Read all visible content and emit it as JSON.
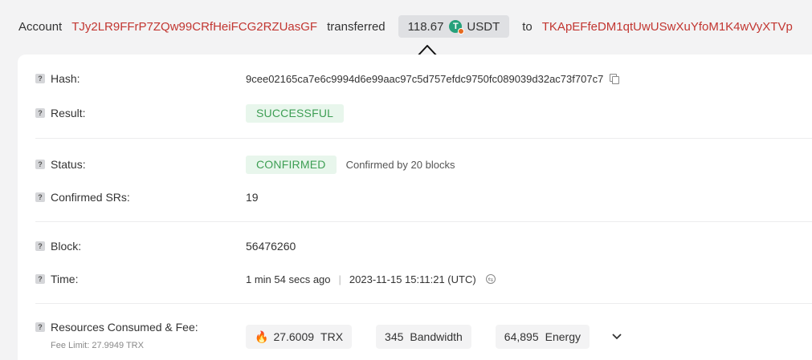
{
  "header": {
    "account_label": "Account",
    "from_address": "TJy2LR9FFrP7ZQw99CRfHeiFCG2RZUasGF",
    "transferred_label": "transferred",
    "amount": "118.67",
    "token_icon": "tether-icon",
    "token_symbol": "USDT",
    "to_label": "to",
    "to_address": "TKApEFfeDM1qtUwUSwXuYfoM1K4wVyXTVp"
  },
  "fields": {
    "hash": {
      "label": "Hash:",
      "value": "9cee02165ca7e6c9994d6e99aac97c5d757efdc9750fc089039d32ac73f707c7"
    },
    "result": {
      "label": "Result:",
      "value": "SUCCESSFUL"
    },
    "status": {
      "label": "Status:",
      "value": "CONFIRMED",
      "confirmed_prefix": "Confirmed by",
      "confirmed_count": "20",
      "confirmed_suffix": "blocks"
    },
    "confirmed_srs": {
      "label": "Confirmed SRs:",
      "value": "19"
    },
    "block": {
      "label": "Block:",
      "value": "56476260"
    },
    "time": {
      "label": "Time:",
      "relative": "1 min 54 secs ago",
      "separator": "|",
      "absolute": "2023-11-15 15:11:21 (UTC)"
    },
    "resources": {
      "label": "Resources Consumed & Fee:",
      "fee_limit": "Fee Limit: 27.9949 TRX",
      "trx_value": "27.6009",
      "trx_unit": "TRX",
      "bandwidth_value": "345",
      "bandwidth_unit": "Bandwidth",
      "energy_value": "64,895",
      "energy_unit": "Energy"
    }
  },
  "help_glyph": "?",
  "colors": {
    "address": "#c23631",
    "success_text": "#3d9e53",
    "success_bg": "#e8f6ec",
    "tether": "#26a17b",
    "fire": "#f26f21"
  }
}
